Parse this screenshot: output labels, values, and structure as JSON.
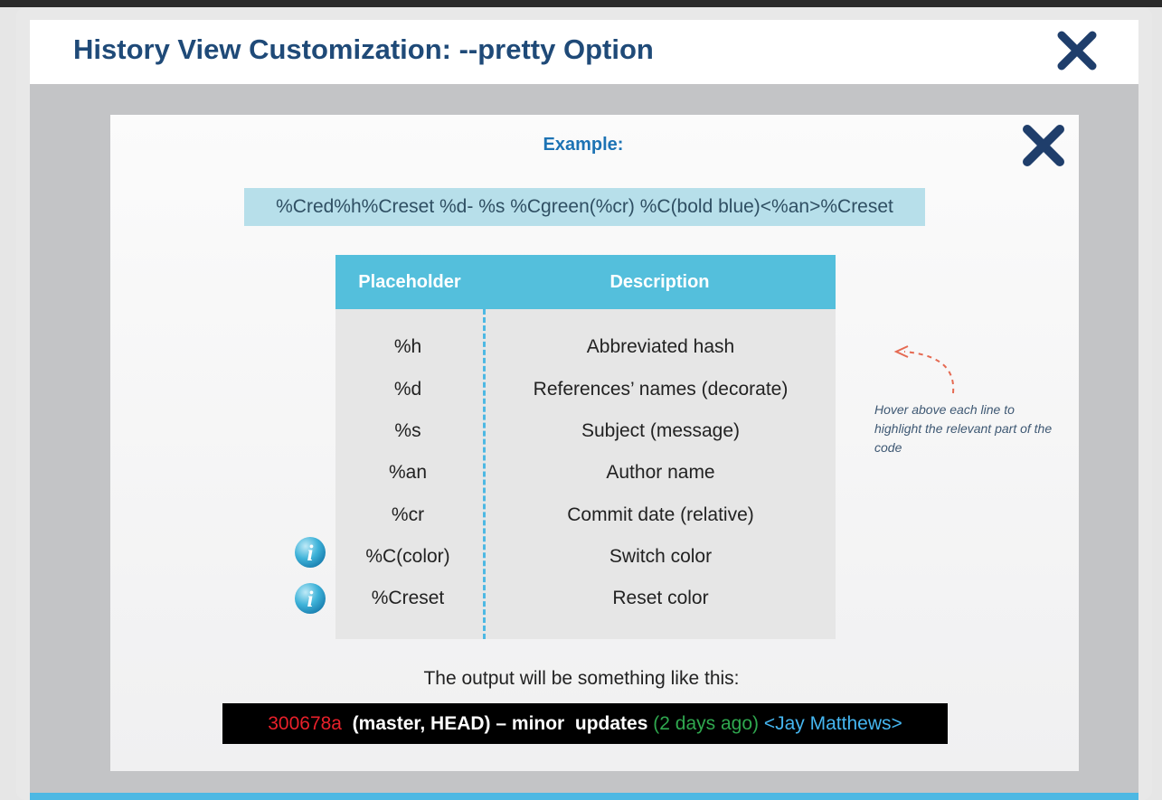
{
  "window": {
    "title": "History View Customization: --pretty Option"
  },
  "panel": {
    "example_label": "Example:",
    "format_string": "%Cred%h%Creset %d- %s %Cgreen(%cr) %C(bold blue)<%an>%Creset",
    "table": {
      "headers": [
        "Placeholder",
        "Description"
      ],
      "rows": [
        {
          "placeholder": "%h",
          "description": "Abbreviated hash",
          "has_info": false
        },
        {
          "placeholder": "%d",
          "description": "References’ names (decorate)",
          "has_info": false
        },
        {
          "placeholder": "%s",
          "description": "Subject (message)",
          "has_info": false
        },
        {
          "placeholder": "%an",
          "description": "Author name",
          "has_info": false
        },
        {
          "placeholder": "%cr",
          "description": "Commit date (relative)",
          "has_info": false
        },
        {
          "placeholder": "%C(color)",
          "description": "Switch color",
          "has_info": true
        },
        {
          "placeholder": "%Creset",
          "description": "Reset color",
          "has_info": true
        }
      ]
    },
    "hint": "Hover above each line to highlight the relevant part of the code",
    "output_label": "The output will be something like this:",
    "output": {
      "hash": "300678a",
      "refs_subject": "(master, HEAD) – minor  updates",
      "date": "(2 days ago)",
      "author": "<Jay Matthews>"
    }
  },
  "icons": {
    "close": "close-x-icon",
    "info": "info-icon",
    "hint_arrow": "curved-arrow-icon"
  },
  "colors": {
    "title": "#1f4a78",
    "accent": "#4db8e3",
    "table_header": "#54bfdc",
    "code_box": "#b7dfea",
    "output_hash": "#e8202a",
    "output_date": "#2fa84f",
    "output_author": "#45b6f0"
  }
}
